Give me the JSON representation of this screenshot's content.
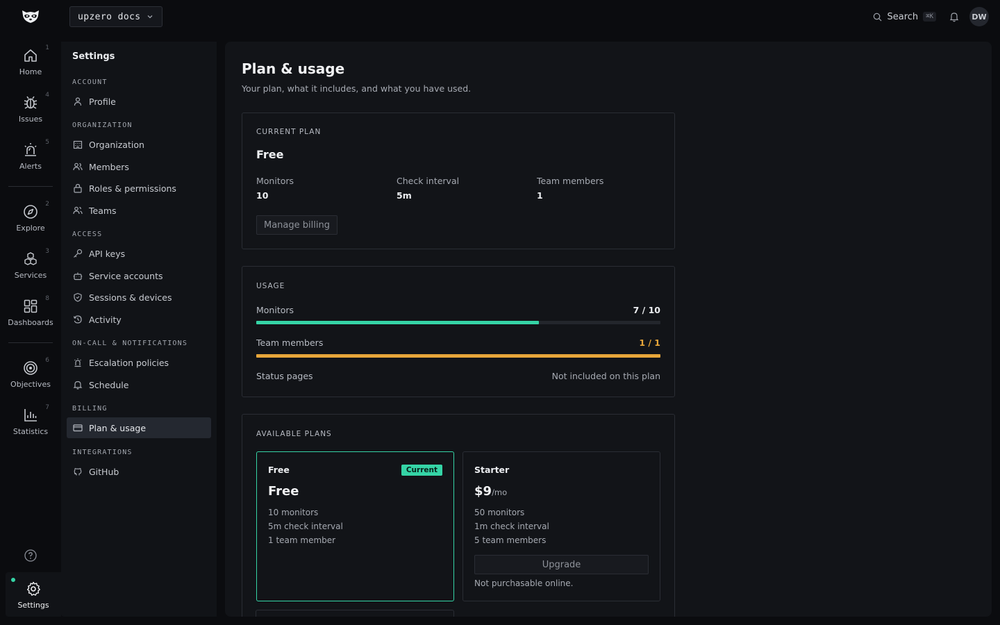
{
  "workspace": {
    "name": "upzero docs"
  },
  "topbar": {
    "search_label": "Search",
    "search_shortcut": "⌘K",
    "avatar_initials": "DW"
  },
  "rail": {
    "items": [
      {
        "label": "Home",
        "num": "1",
        "icon": "home-icon"
      },
      {
        "label": "Issues",
        "num": "4",
        "icon": "bug-icon"
      },
      {
        "label": "Alerts",
        "num": "5",
        "icon": "siren-icon"
      },
      {
        "label": "Explore",
        "num": "2",
        "icon": "compass-icon"
      },
      {
        "label": "Services",
        "num": "3",
        "icon": "cubes-icon"
      },
      {
        "label": "Dashboards",
        "num": "8",
        "icon": "grid-icon"
      },
      {
        "label": "Objectives",
        "num": "6",
        "icon": "target-icon"
      },
      {
        "label": "Statistics",
        "num": "7",
        "icon": "bar-chart-icon"
      }
    ],
    "settings_label": "Settings",
    "accent": "#35d4a6"
  },
  "sidebar": {
    "title": "Settings",
    "sections": [
      {
        "heading": "ACCOUNT",
        "items": [
          "Profile"
        ]
      },
      {
        "heading": "ORGANIZATION",
        "items": [
          "Organization",
          "Members",
          "Roles & permissions",
          "Teams"
        ]
      },
      {
        "heading": "ACCESS",
        "items": [
          "API keys",
          "Service accounts",
          "Sessions & devices",
          "Activity"
        ]
      },
      {
        "heading": "ON-CALL & NOTIFICATIONS",
        "items": [
          "Escalation policies",
          "Schedule"
        ]
      },
      {
        "heading": "BILLING",
        "items": [
          "Plan & usage"
        ]
      },
      {
        "heading": "INTEGRATIONS",
        "items": [
          "GitHub"
        ]
      }
    ],
    "active_item": "Plan & usage"
  },
  "page": {
    "title": "Plan & usage",
    "subtitle": "Your plan, what it includes, and what you have used."
  },
  "current_plan": {
    "label": "CURRENT PLAN",
    "name": "Free",
    "stats": [
      {
        "label": "Monitors",
        "value": "10"
      },
      {
        "label": "Check interval",
        "value": "5m"
      },
      {
        "label": "Team members",
        "value": "1"
      }
    ],
    "manage_label": "Manage billing"
  },
  "usage": {
    "label": "USAGE",
    "rows": [
      {
        "label": "Monitors",
        "value": "7 / 10",
        "used": 7,
        "limit": 10,
        "color": "#35d4a6"
      },
      {
        "label": "Team members",
        "value": "1 / 1",
        "used": 1,
        "limit": 1,
        "color": "#e7a63a"
      }
    ],
    "status_pages": {
      "label": "Status pages",
      "value": "Not included on this plan"
    }
  },
  "available_plans": {
    "label": "AVAILABLE PLANS",
    "plans": [
      {
        "name": "Free",
        "badge": "Current",
        "price": "Free",
        "per": "",
        "features": [
          "10 monitors",
          "5m check interval",
          "1 team member"
        ]
      },
      {
        "name": "Starter",
        "price": "$9",
        "per": "/mo",
        "features": [
          "50 monitors",
          "1m check interval",
          "5 team members"
        ],
        "button": "Upgrade",
        "note": "Not purchasable online."
      }
    ]
  }
}
